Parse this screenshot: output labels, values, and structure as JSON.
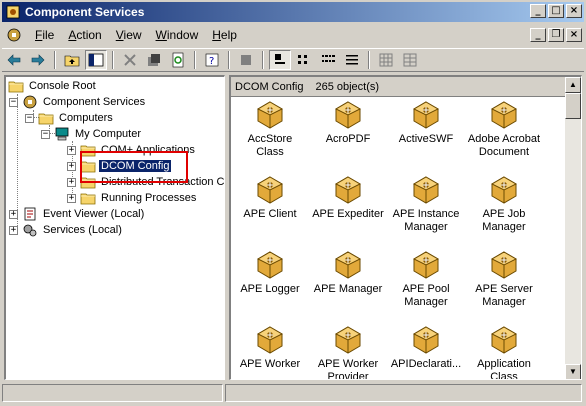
{
  "window": {
    "title": "Component Services",
    "controls": {
      "minimize": "_",
      "maximize": "□",
      "close": "×"
    }
  },
  "menu": {
    "items": [
      {
        "label": "File",
        "u": "F",
        "rest": "ile"
      },
      {
        "label": "Action",
        "u": "A",
        "rest": "ction"
      },
      {
        "label": "View",
        "u": "V",
        "rest": "iew"
      },
      {
        "label": "Window",
        "u": "W",
        "rest": "indow"
      },
      {
        "label": "Help",
        "u": "H",
        "rest": "elp"
      }
    ],
    "mdi_controls": {
      "minimize": "_",
      "restore": "❐",
      "close": "×"
    }
  },
  "tree": {
    "nodes": [
      {
        "label": "Console Root",
        "icon": "folder-icon"
      },
      {
        "label": "Component Services",
        "icon": "component-services-icon"
      },
      {
        "label": "Computers",
        "icon": "folder-icon"
      },
      {
        "label": "My Computer",
        "icon": "computer-icon"
      },
      {
        "label": "COM+ Applications",
        "icon": "folder-icon"
      },
      {
        "label": "DCOM Config",
        "icon": "folder-icon"
      },
      {
        "label": "Distributed Transaction C",
        "icon": "folder-icon"
      },
      {
        "label": "Running Processes",
        "icon": "folder-icon"
      },
      {
        "label": "Event Viewer (Local)",
        "icon": "event-viewer-icon"
      },
      {
        "label": "Services (Local)",
        "icon": "services-icon"
      }
    ],
    "expanders": {
      "plus": "+",
      "minus": "−"
    }
  },
  "right_pane": {
    "header_title": "DCOM Config",
    "object_count": "265 object(s)",
    "objects": [
      {
        "line1": "AccStore",
        "line2": "Class"
      },
      {
        "line1": "AcroPDF",
        "line2": ""
      },
      {
        "line1": "ActiveSWF",
        "line2": ""
      },
      {
        "line1": "Adobe Acrobat",
        "line2": "Document"
      },
      {
        "line1": "APE Client",
        "line2": ""
      },
      {
        "line1": "APE Expediter",
        "line2": ""
      },
      {
        "line1": "APE Instance",
        "line2": "Manager"
      },
      {
        "line1": "APE Job",
        "line2": "Manager"
      },
      {
        "line1": "APE Logger",
        "line2": ""
      },
      {
        "line1": "APE Manager",
        "line2": ""
      },
      {
        "line1": "APE Pool",
        "line2": "Manager"
      },
      {
        "line1": "APE Server",
        "line2": "Manager"
      },
      {
        "line1": "APE Worker",
        "line2": ""
      },
      {
        "line1": "APE Worker",
        "line2": "Provider"
      },
      {
        "line1": "APIDeclarati...",
        "line2": ""
      },
      {
        "line1": "Application",
        "line2": "Class"
      }
    ]
  },
  "scrollbar": {
    "up": "▲",
    "down": "▼"
  },
  "colors": {
    "titlebar_start": "#0a246a",
    "titlebar_end": "#a6caf0",
    "selection": "#0a246a",
    "highlight": "#e00000"
  }
}
